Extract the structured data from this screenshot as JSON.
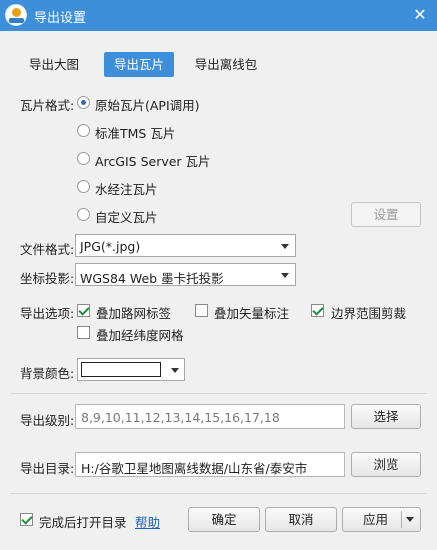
{
  "window": {
    "title": "导出设置",
    "close_glyph": "✕"
  },
  "tabs": [
    {
      "label": "导出大图"
    },
    {
      "label": "导出瓦片"
    },
    {
      "label": "导出离线包"
    }
  ],
  "tile_format": {
    "label": "瓦片格式:",
    "options": [
      {
        "label": "原始瓦片(API调用)",
        "selected": true
      },
      {
        "label": "标准TMS 瓦片",
        "selected": false
      },
      {
        "label": "ArcGIS Server 瓦片",
        "selected": false
      },
      {
        "label": "水经注瓦片",
        "selected": false
      },
      {
        "label": "自定义瓦片",
        "selected": false
      }
    ],
    "settings_button": "设置"
  },
  "file_format": {
    "label": "文件格式:",
    "value": "JPG(*.jpg)"
  },
  "projection": {
    "label": "坐标投影:",
    "value": "WGS84 Web 墨卡托投影"
  },
  "export_options": {
    "label": "导出选项:",
    "items": [
      {
        "label": "叠加路网标签",
        "checked": true
      },
      {
        "label": "叠加矢量标注",
        "checked": false
      },
      {
        "label": "边界范围剪裁",
        "checked": true
      },
      {
        "label": "叠加经纬度网格",
        "checked": false
      }
    ]
  },
  "background_color": {
    "label": "背景颜色:",
    "value": "#ffffff"
  },
  "export_levels": {
    "label": "导出级别:",
    "value": "8,9,10,11,12,13,14,15,16,17,18",
    "button": "选择"
  },
  "export_dir": {
    "label": "导出目录:",
    "value": "H:/谷歌卫星地图离线数据/山东省/泰安市",
    "button": "浏览"
  },
  "footer": {
    "open_after": {
      "label": "完成后打开目录",
      "checked": true
    },
    "help_link": "帮助",
    "ok_button": "确定",
    "cancel_button": "取消",
    "apply_button": "应用"
  }
}
